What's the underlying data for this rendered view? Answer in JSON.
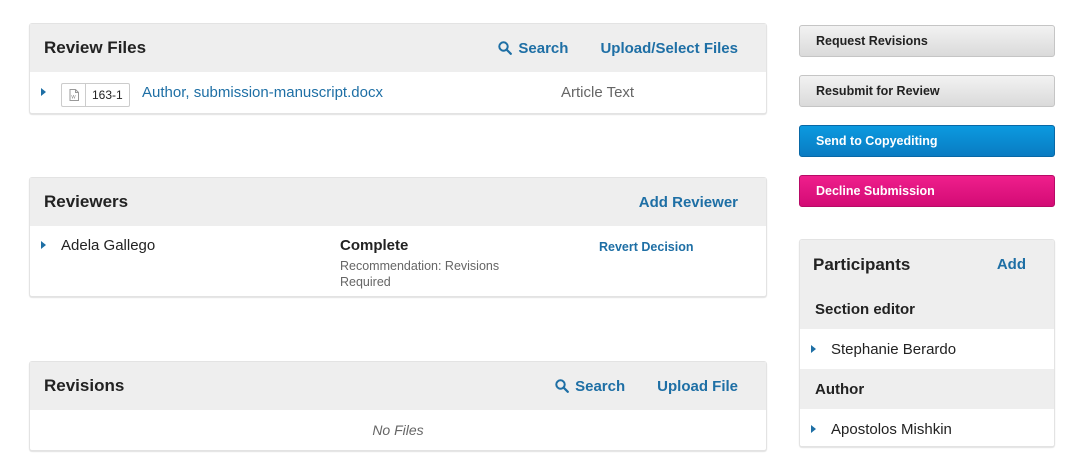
{
  "review_files": {
    "title": "Review Files",
    "search_label": "Search",
    "upload_label": "Upload/Select Files",
    "files": [
      {
        "id": "163-1",
        "name": "Author, submission-manuscript.docx",
        "type": "Article Text"
      }
    ]
  },
  "reviewers": {
    "title": "Reviewers",
    "add_label": "Add Reviewer",
    "items": [
      {
        "name": "Adela Gallego",
        "status": "Complete",
        "recommendation": "Recommendation: Revisions Required",
        "action": "Revert Decision"
      }
    ]
  },
  "revisions": {
    "title": "Revisions",
    "search_label": "Search",
    "upload_label": "Upload File",
    "empty_text": "No Files"
  },
  "actions": {
    "request_revisions": "Request Revisions",
    "resubmit_for_review": "Resubmit for Review",
    "send_to_copyediting": "Send to Copyediting",
    "decline_submission": "Decline Submission"
  },
  "participants": {
    "title": "Participants",
    "add_label": "Add",
    "groups": [
      {
        "label": "Section editor",
        "people": [
          "Stephanie Berardo"
        ]
      },
      {
        "label": "Author",
        "people": [
          "Apostolos Mishkin"
        ]
      }
    ]
  },
  "colors": {
    "link": "#1e6fa5",
    "primary_button": "#0a82c9",
    "danger_button": "#e0107f",
    "panel_header": "#eeeeee"
  }
}
